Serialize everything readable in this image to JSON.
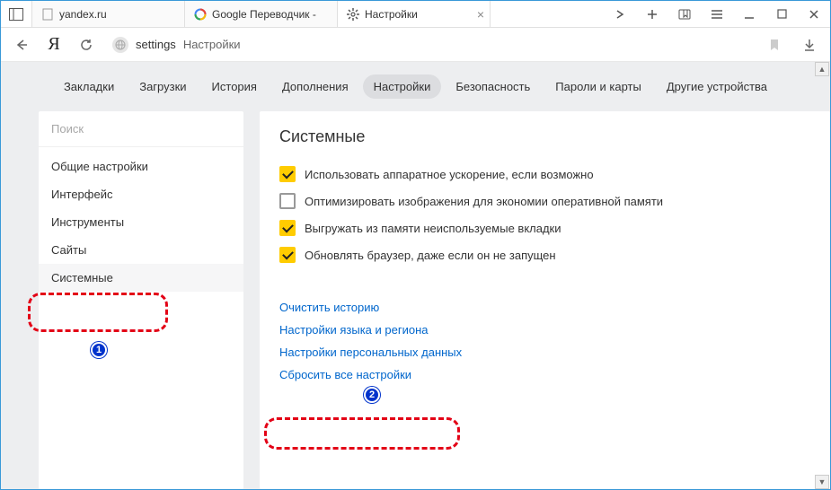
{
  "titlebar": {
    "tabs": [
      {
        "label": "yandex.ru",
        "icon": "page"
      },
      {
        "label": "Google Переводчик -",
        "icon": "google"
      },
      {
        "label": "Настройки",
        "icon": "gear",
        "active": true
      }
    ]
  },
  "addressbar": {
    "domain": "settings",
    "page": "Настройки"
  },
  "topnav": {
    "items": [
      "Закладки",
      "Загрузки",
      "История",
      "Дополнения",
      "Настройки",
      "Безопасность",
      "Пароли и карты",
      "Другие устройства"
    ],
    "active_index": 4
  },
  "sidebar": {
    "search_placeholder": "Поиск",
    "items": [
      "Общие настройки",
      "Интерфейс",
      "Инструменты",
      "Сайты",
      "Системные"
    ],
    "active_index": 4
  },
  "main": {
    "heading": "Системные",
    "checkboxes": [
      {
        "checked": true,
        "label": "Использовать аппаратное ускорение, если возможно"
      },
      {
        "checked": false,
        "label": "Оптимизировать изображения для экономии оперативной памяти"
      },
      {
        "checked": true,
        "label": "Выгружать из памяти неиспользуемые вкладки"
      },
      {
        "checked": true,
        "label": "Обновлять браузер, даже если он не запущен"
      }
    ],
    "links": [
      "Очистить историю",
      "Настройки языка и региона",
      "Настройки персональных данных",
      "Сбросить все настройки"
    ]
  },
  "annotations": {
    "badge1": "1",
    "badge2": "2"
  }
}
